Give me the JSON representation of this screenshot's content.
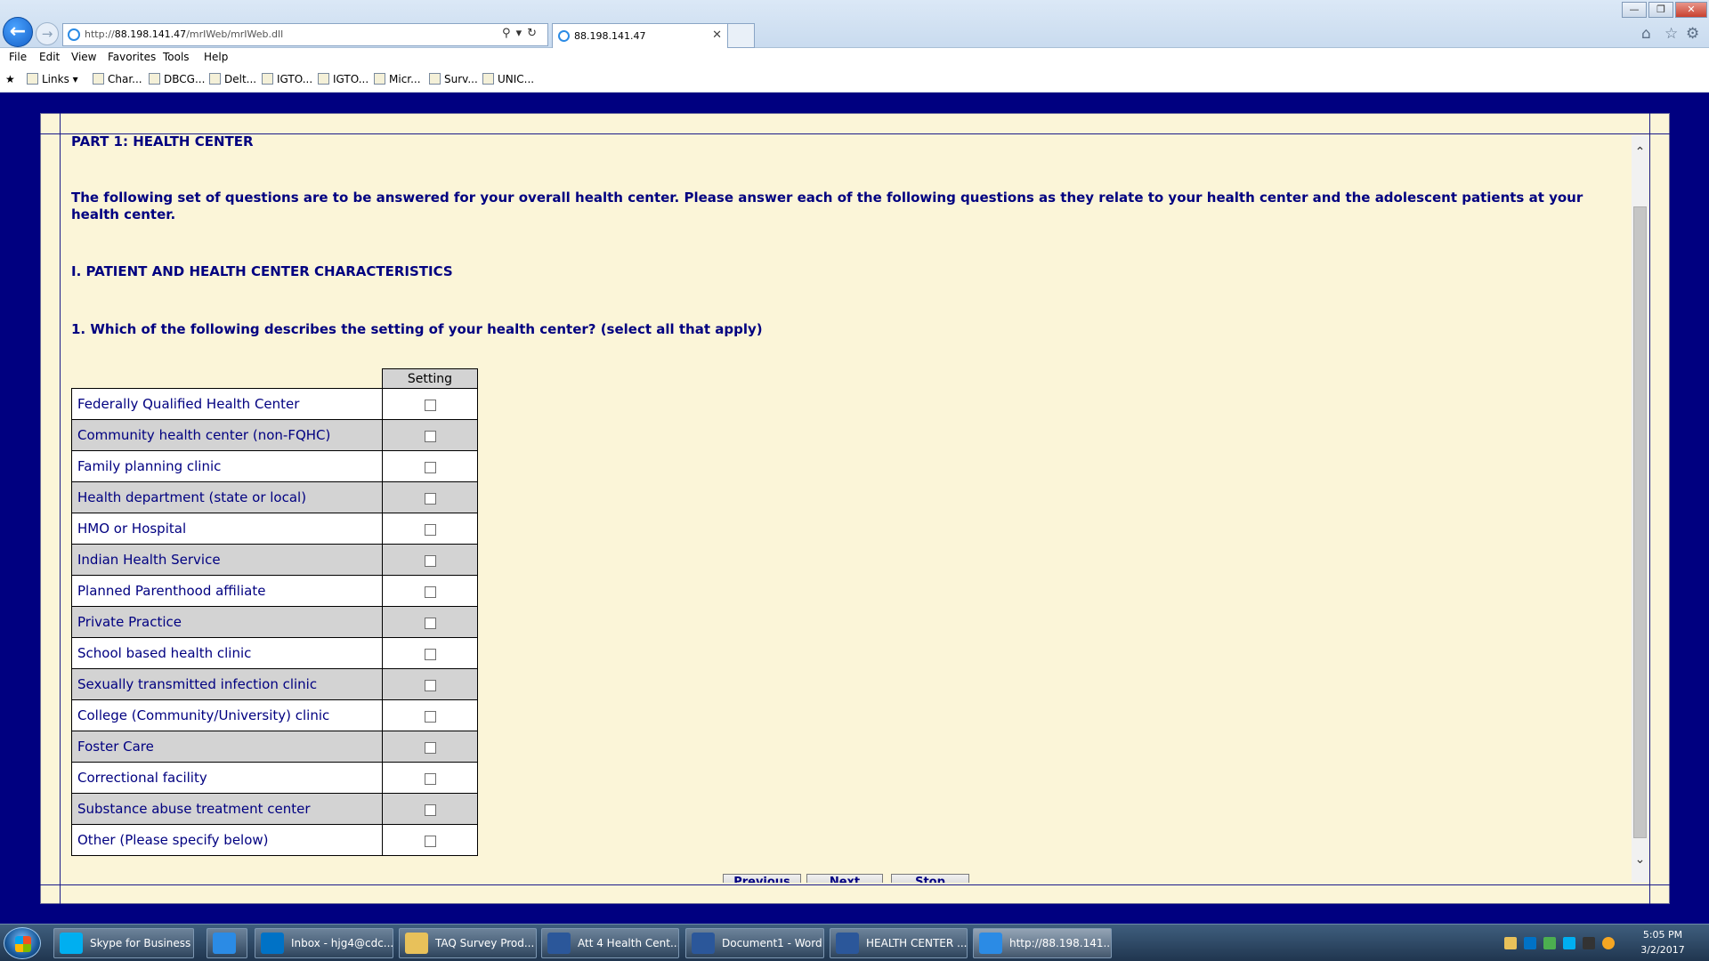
{
  "browser": {
    "url_prefix": "http://",
    "url_host": "88.198.141.47",
    "url_path": "/mrIWeb/mrIWeb.dll",
    "tab_title": "88.198.141.47"
  },
  "menu": [
    "File",
    "Edit",
    "View",
    "Favorites",
    "Tools",
    "Help"
  ],
  "favorites": [
    "Links",
    "Char...",
    "DBCG...",
    "Delt...",
    "IGTO...",
    "IGTO...",
    "Micr...",
    "Surv...",
    "UNIC..."
  ],
  "survey": {
    "part_title": "PART 1: HEALTH CENTER",
    "intro": "The following set of questions are to be answered for your overall health center. Please answer each of the following questions as they relate to your health center and the adolescent patients at your health center.",
    "section_title": "I. PATIENT AND HEALTH CENTER CHARACTERISTICS",
    "question": "1. Which of the following describes the setting of your health center? (select all that apply)",
    "column_header": "Setting",
    "options": [
      "Federally Qualified Health Center",
      "Community health center (non-FQHC)",
      "Family planning clinic",
      "Health department (state or local)",
      "HMO or Hospital",
      "Indian Health Service",
      "Planned Parenthood affiliate",
      "Private Practice",
      "School based health clinic",
      "Sexually transmitted infection clinic",
      "College (Community/University) clinic",
      "Foster Care",
      "Correctional facility",
      "Substance abuse treatment center",
      "Other (Please specify below)"
    ],
    "buttons": {
      "previous": "Previous",
      "next": "Next",
      "stop": "Stop"
    }
  },
  "taskbar": {
    "items": [
      {
        "label": "Skype for Business",
        "icon": "skype-icon",
        "color": "#00aff0"
      },
      {
        "label": "",
        "icon": "ie-icon",
        "color": "#2b8be5"
      },
      {
        "label": "Inbox - hjg4@cdc...",
        "icon": "outlook-icon",
        "color": "#0072c6"
      },
      {
        "label": "TAQ Survey Prod...",
        "icon": "folder-icon",
        "color": "#e8c15a"
      },
      {
        "label": "Att 4 Health Cent...",
        "icon": "word-icon",
        "color": "#2b579a"
      },
      {
        "label": "Document1 - Word",
        "icon": "word-icon",
        "color": "#2b579a"
      },
      {
        "label": "HEALTH CENTER ...",
        "icon": "word-icon",
        "color": "#2b579a"
      },
      {
        "label": "http://88.198.141....",
        "icon": "ie-icon",
        "color": "#2b8be5"
      }
    ],
    "time": "5:05 PM",
    "date": "3/2/2017"
  }
}
